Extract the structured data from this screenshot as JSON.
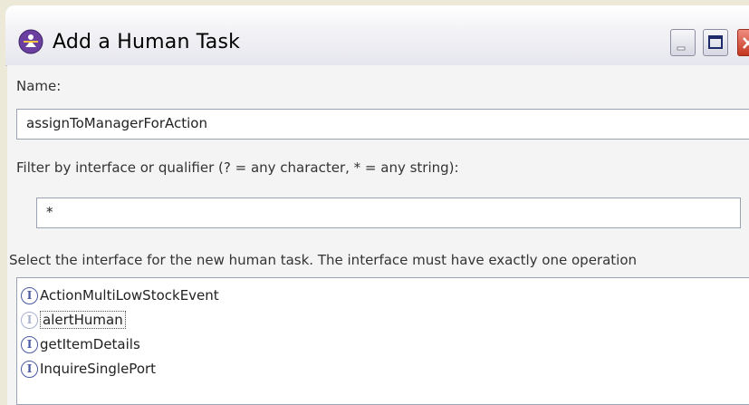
{
  "window": {
    "title": "Add a Human Task"
  },
  "form": {
    "name_label": "Name:",
    "name_value": "assignToManagerForAction",
    "filter_label": "Filter by interface or qualifier (? = any character, * = any string):",
    "filter_value": "*",
    "select_label": "Select the interface for the new human task. The interface must have exactly one operation"
  },
  "interfaces": {
    "items": [
      {
        "label": "ActionMultiLowStockEvent",
        "icon": "interface-icon"
      },
      {
        "label": "alertHuman",
        "icon": "interface-icon",
        "selected": true
      },
      {
        "label": "getItemDetails",
        "icon": "interface-icon"
      },
      {
        "label": "InquireSinglePort",
        "icon": "interface-icon"
      }
    ]
  },
  "colors": {
    "icon_accent": "#4a5aa3",
    "title_bar": "#e6e6ee",
    "close_button": "#c4361f"
  }
}
